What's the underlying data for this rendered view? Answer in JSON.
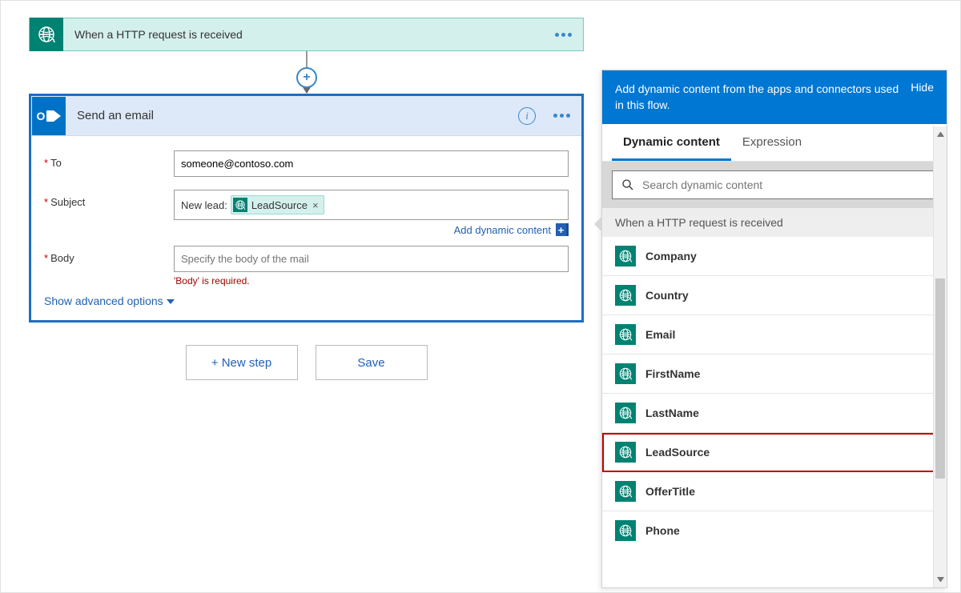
{
  "trigger": {
    "title": "When a HTTP request is received"
  },
  "action": {
    "title": "Send an email",
    "fields": {
      "to_label": "To",
      "to_value": "someone@contoso.com",
      "subject_label": "Subject",
      "subject_prefix": "New lead:",
      "subject_token": "LeadSource",
      "body_label": "Body",
      "body_placeholder": "Specify the body of the mail",
      "body_error": "'Body' is required."
    },
    "add_dc": "Add dynamic content",
    "advanced": "Show advanced options"
  },
  "buttons": {
    "new_step": "+ New step",
    "save": "Save"
  },
  "dc_panel": {
    "intro": "Add dynamic content from the apps and connectors used in this flow.",
    "hide": "Hide",
    "tab_dc": "Dynamic content",
    "tab_expr": "Expression",
    "search_placeholder": "Search dynamic content",
    "group_title": "When a HTTP request is received",
    "items": [
      "Company",
      "Country",
      "Email",
      "FirstName",
      "LastName",
      "LeadSource",
      "OfferTitle",
      "Phone"
    ],
    "highlight": "LeadSource"
  }
}
